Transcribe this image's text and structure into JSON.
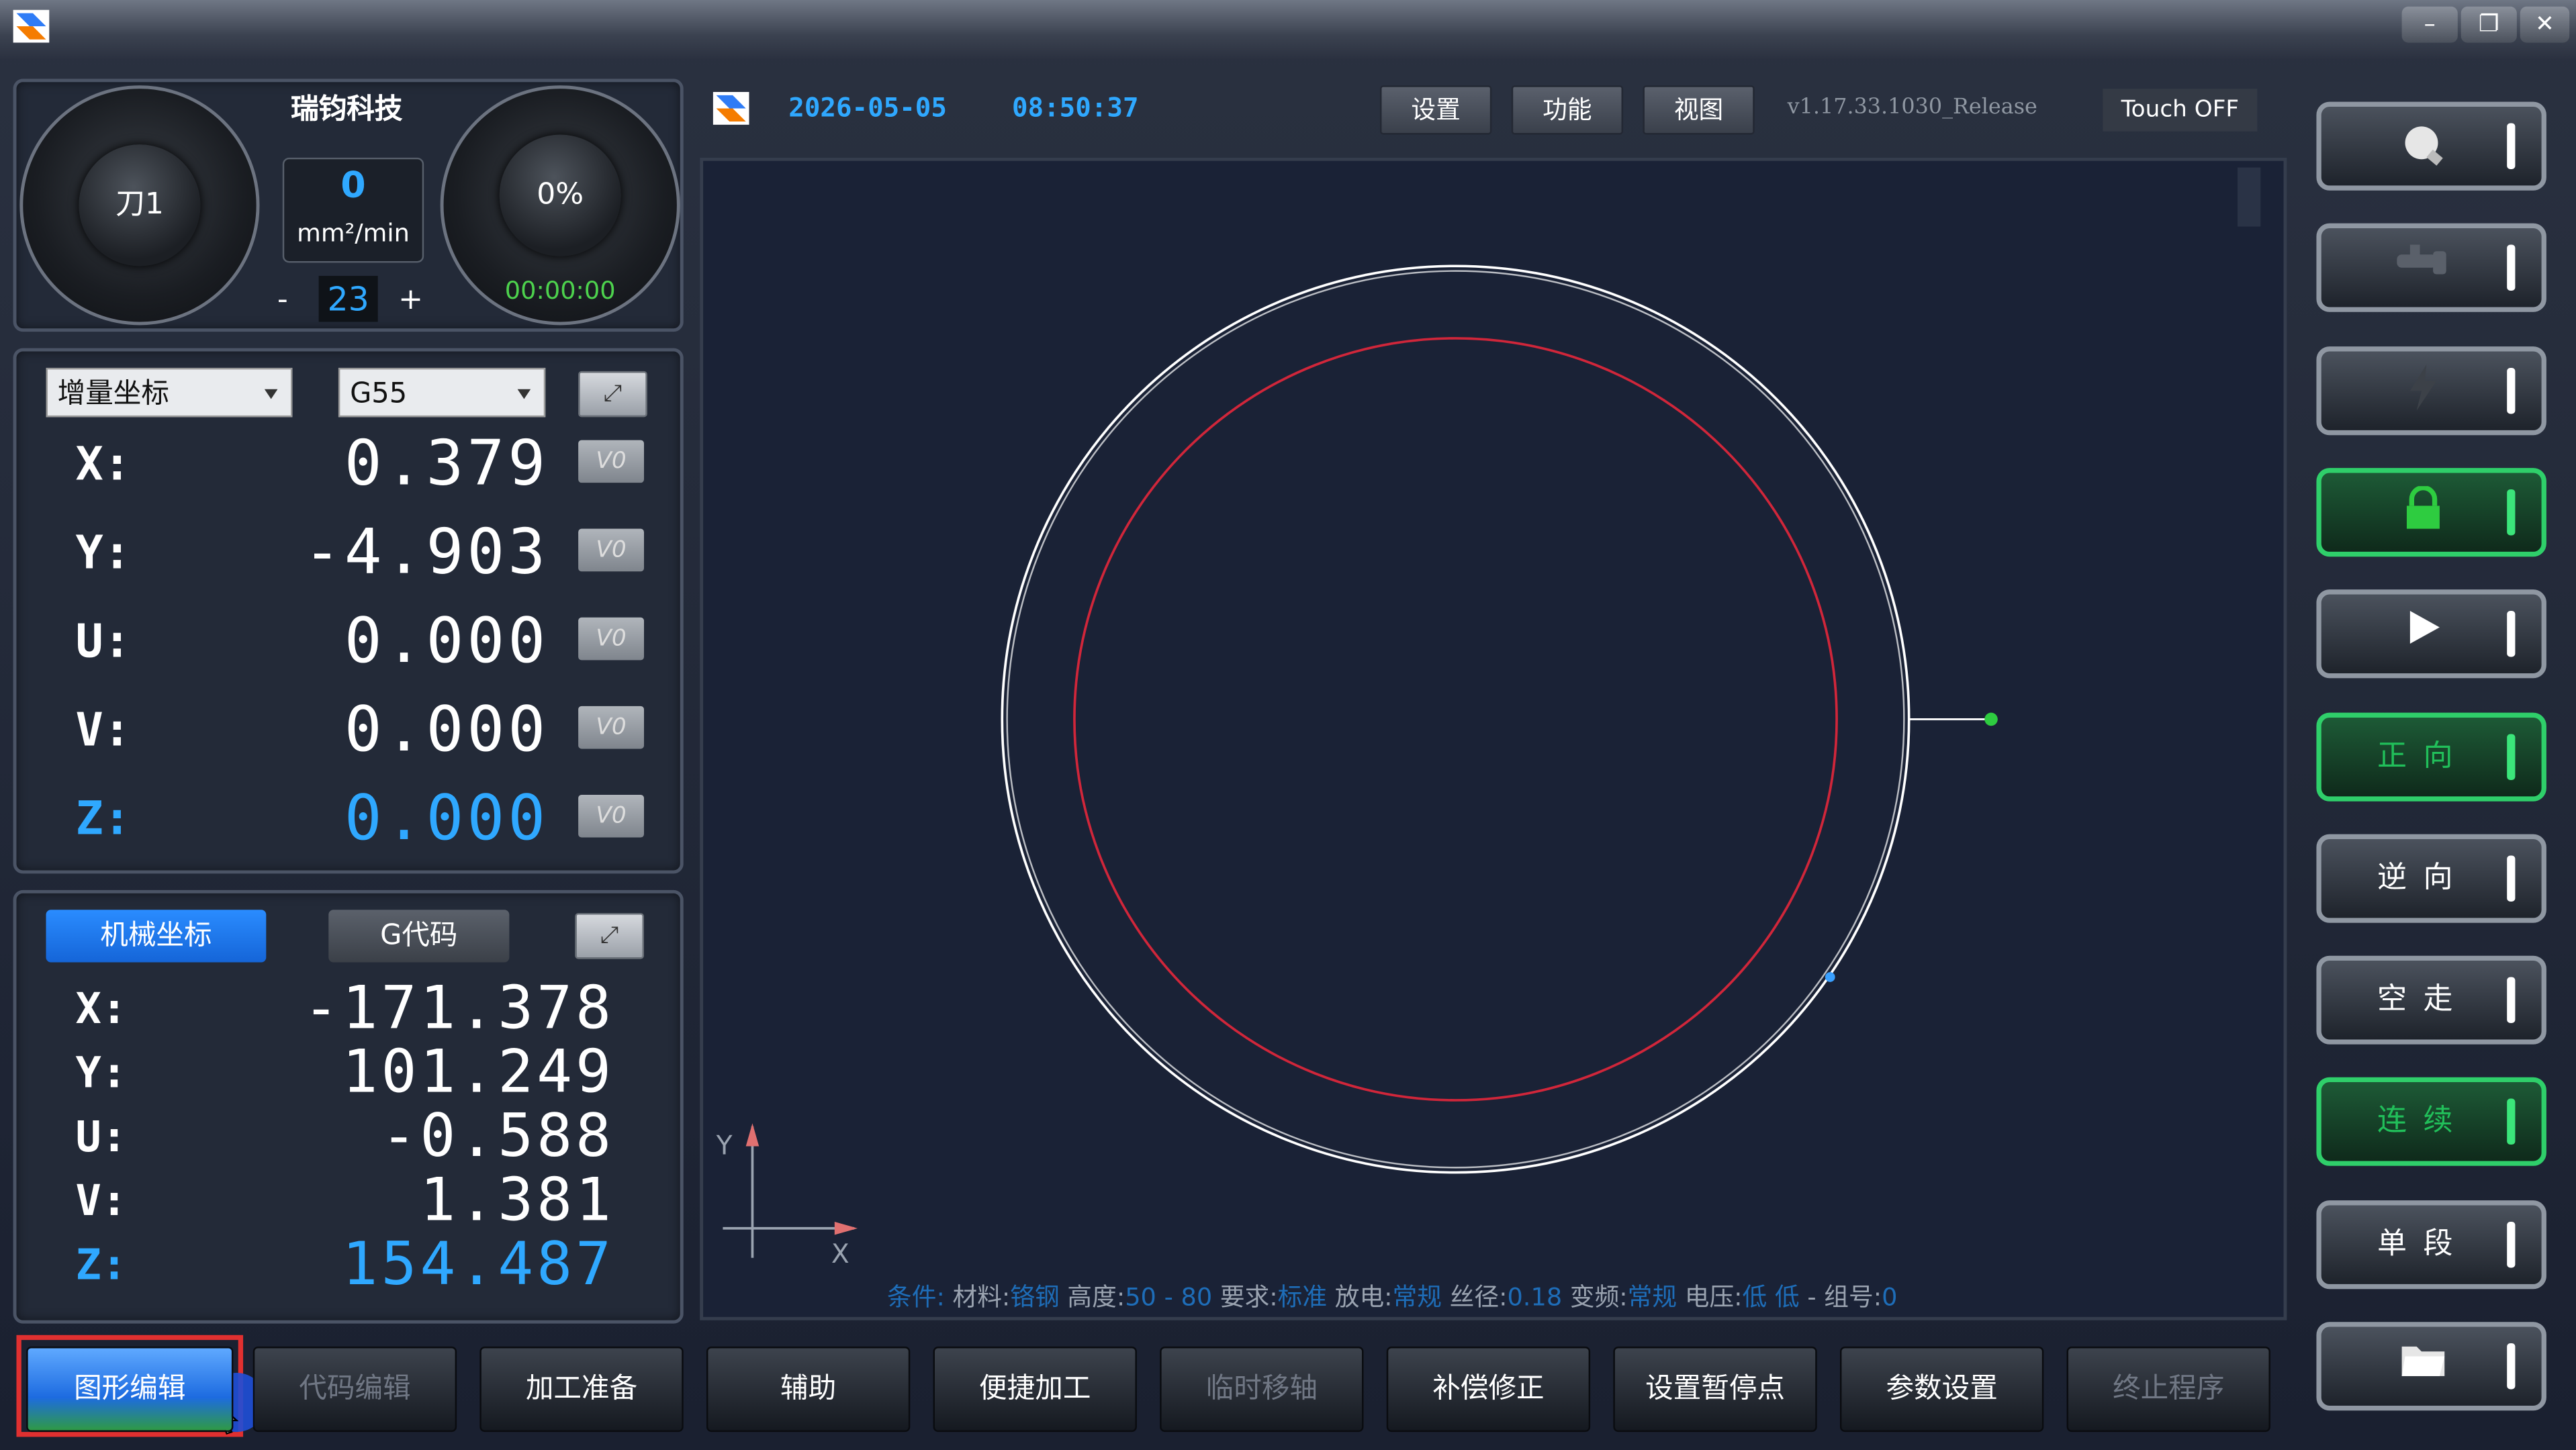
{
  "header": {
    "date": "2026-05-05",
    "time": "08:50:37",
    "menu": [
      "设置",
      "功能",
      "视图"
    ],
    "version": "v1.17.33.1030_Release",
    "touch": "Touch OFF"
  },
  "gauge": {
    "brand": "瑞钧科技",
    "tool": "刀1",
    "rate_value": "0",
    "rate_unit": "mm²/min",
    "minus": "-",
    "plus": "+",
    "step": "23",
    "percent": "0%",
    "timer": "00:00:00"
  },
  "coords": {
    "mode": "增量坐标",
    "wcs": "G55",
    "reset_label": "V0",
    "rows": [
      {
        "axis": "X:",
        "value": "0.379"
      },
      {
        "axis": "Y:",
        "value": "-4.903"
      },
      {
        "axis": "U:",
        "value": "0.000"
      },
      {
        "axis": "V:",
        "value": "0.000"
      },
      {
        "axis": "Z:",
        "value": "0.000"
      }
    ]
  },
  "machine": {
    "tab_active": "机械坐标",
    "tab_inactive": "G代码",
    "rows": [
      {
        "axis": "X:",
        "value": "-171.378"
      },
      {
        "axis": "Y:",
        "value": "101.249"
      },
      {
        "axis": "U:",
        "value": "-0.588"
      },
      {
        "axis": "V:",
        "value": "1.381"
      },
      {
        "axis": "Z:",
        "value": "154.487"
      }
    ]
  },
  "canvas": {
    "y_label": "Y",
    "x_label": "X"
  },
  "status": {
    "cond_label": "条件:",
    "material_label": "材料:",
    "material": "铬钢",
    "height_label": "高度:",
    "height": "50 - 80",
    "req_label": "要求:",
    "req": "标准",
    "discharge_label": "放电:",
    "discharge": "常规",
    "wire_label": "丝径:",
    "wire": "0.18",
    "freq_label": "变频:",
    "freq": "常规",
    "volt_label": "电压:",
    "volt": "低 低",
    "group_label": "组号:",
    "group": "0"
  },
  "right_buttons": [
    {
      "name": "light",
      "label": "",
      "icon": "bulb-icon",
      "state": "normal"
    },
    {
      "name": "pump",
      "label": "",
      "icon": "faucet-icon",
      "state": "normal"
    },
    {
      "name": "power",
      "label": "",
      "icon": "lightning-icon",
      "state": "dim"
    },
    {
      "name": "lock",
      "label": "",
      "icon": "lock-icon",
      "state": "green"
    },
    {
      "name": "run",
      "label": "",
      "icon": "play-icon",
      "state": "normal"
    },
    {
      "name": "forward",
      "label": "正向",
      "icon": "",
      "state": "green"
    },
    {
      "name": "reverse",
      "label": "逆向",
      "icon": "",
      "state": "normal"
    },
    {
      "name": "dry-run",
      "label": "空走",
      "icon": "",
      "state": "normal"
    },
    {
      "name": "continuous",
      "label": "连续",
      "icon": "",
      "state": "green"
    },
    {
      "name": "single",
      "label": "单段",
      "icon": "",
      "state": "normal"
    },
    {
      "name": "open",
      "label": "",
      "icon": "folder-icon",
      "state": "normal"
    }
  ],
  "bottom_buttons": [
    {
      "label": "图形编辑",
      "state": "selected"
    },
    {
      "label": "代码编辑",
      "state": "dim"
    },
    {
      "label": "加工准备",
      "state": "normal"
    },
    {
      "label": "辅助",
      "state": "normal"
    },
    {
      "label": "便捷加工",
      "state": "normal"
    },
    {
      "label": "临时移轴",
      "state": "dim"
    },
    {
      "label": "补偿修正",
      "state": "normal"
    },
    {
      "label": "设置暂停点",
      "state": "normal"
    },
    {
      "label": "参数设置",
      "state": "normal"
    },
    {
      "label": "终止程序",
      "state": "dim"
    }
  ],
  "colors": {
    "accent_blue": "#2fa8ff",
    "path_white": "#ffffff",
    "path_red": "#d0263a",
    "start_green": "#2ecc40",
    "green_state": "#2fcf6a",
    "highlight_red": "#e03030"
  }
}
